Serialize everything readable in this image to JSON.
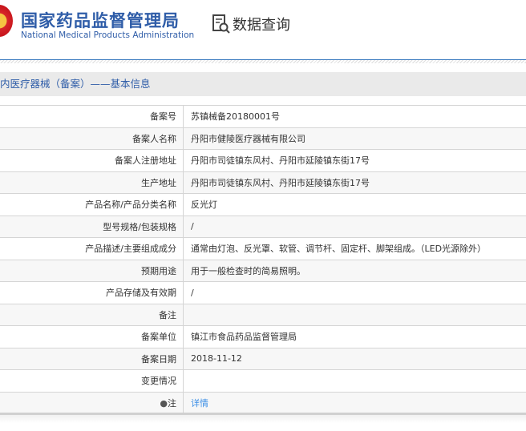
{
  "header": {
    "title_cn": "国家药品监督管理局",
    "title_en": "National Medical Products Administration",
    "query_title": "数据查询"
  },
  "section_title": "内医疗器械（备案）——基本信息",
  "rows": [
    {
      "label": "备案号",
      "value": "苏镇械备20180001号"
    },
    {
      "label": "备案人名称",
      "value": "丹阳市健陵医疗器械有限公司"
    },
    {
      "label": "备案人注册地址",
      "value": "丹阳市司徒镇东风村、丹阳市延陵镇东街17号"
    },
    {
      "label": "生产地址",
      "value": "丹阳市司徒镇东风村、丹阳市延陵镇东街17号"
    },
    {
      "label": "产品名称/产品分类名称",
      "value": "反光灯"
    },
    {
      "label": "型号规格/包装规格",
      "value": "/"
    },
    {
      "label": "产品描述/主要组成成分",
      "value": "通常由灯泡、反光罩、软管、调节杆、固定杆、脚架组成。（LED光源除外）"
    },
    {
      "label": "预期用途",
      "value": "用于一般检查时的简易照明。"
    },
    {
      "label": "产品存储及有效期",
      "value": "/"
    },
    {
      "label": "备注",
      "value": ""
    },
    {
      "label": "备案单位",
      "value": "镇江市食品药品监督管理局"
    },
    {
      "label": "备案日期",
      "value": "2018-11-12"
    },
    {
      "label": "变更情况",
      "value": ""
    }
  ],
  "note": {
    "label": "注",
    "link": "详情",
    "icon": "bulb-icon"
  }
}
